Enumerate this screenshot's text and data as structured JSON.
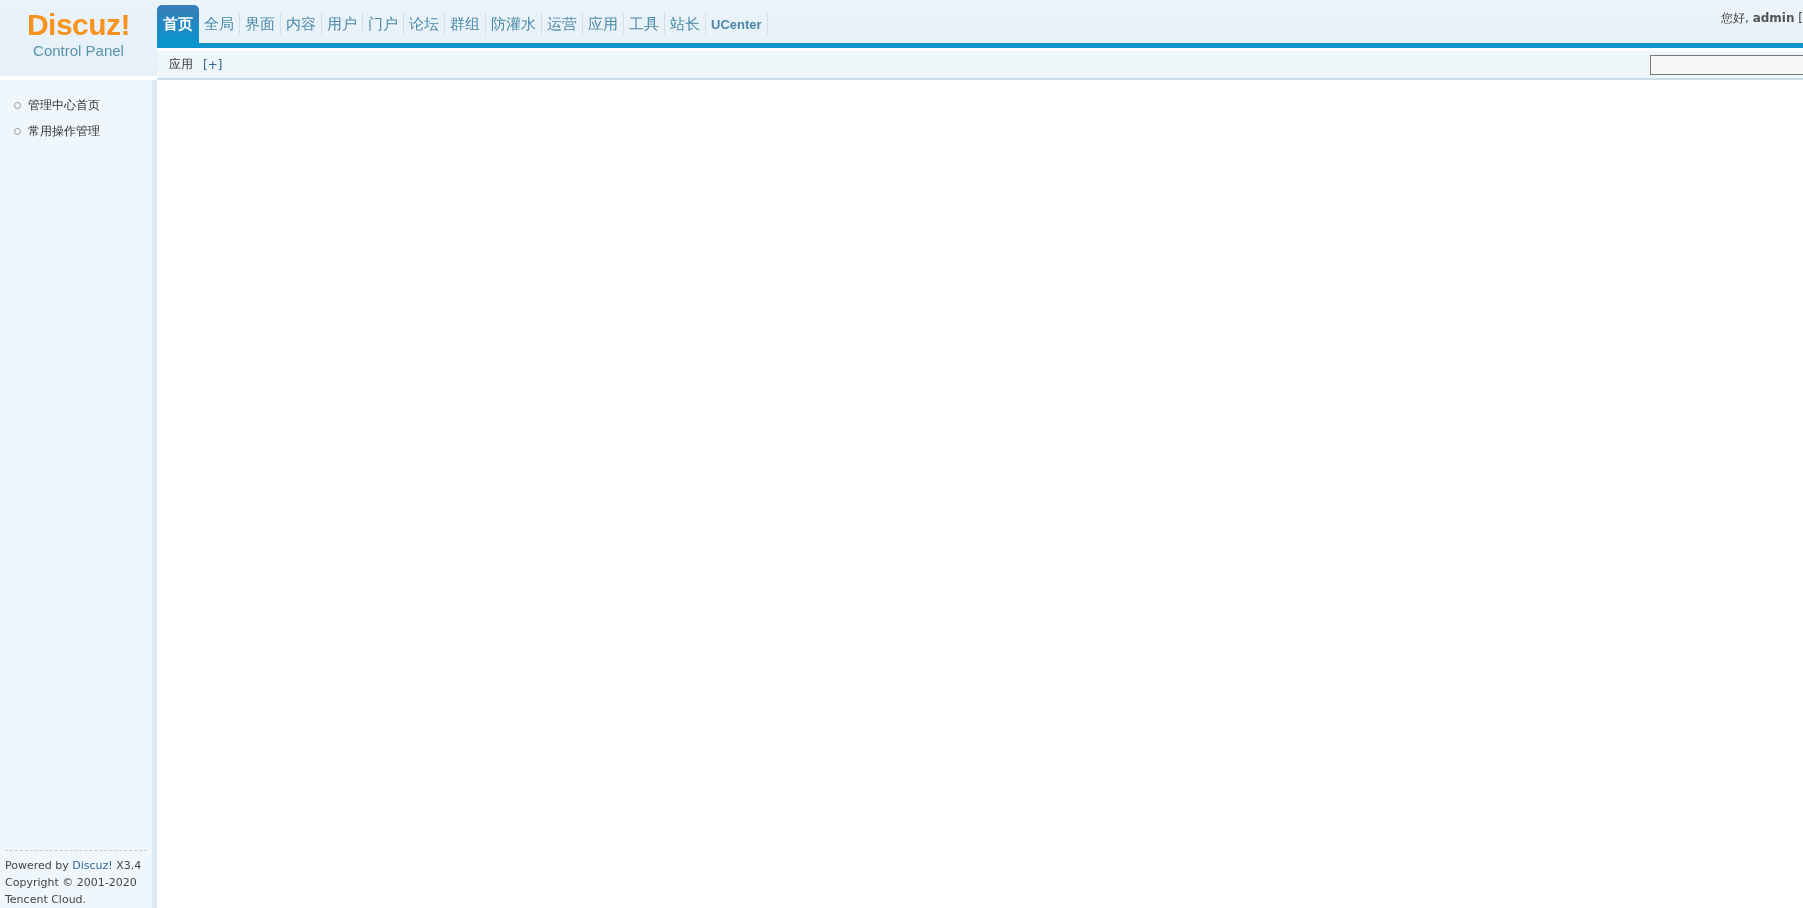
{
  "logo": {
    "title": "Discuz!",
    "subtitle": "Control Panel"
  },
  "tabs": [
    {
      "label": "首页",
      "selected": true
    },
    {
      "label": "全局",
      "selected": false
    },
    {
      "label": "界面",
      "selected": false
    },
    {
      "label": "内容",
      "selected": false
    },
    {
      "label": "用户",
      "selected": false
    },
    {
      "label": "门户",
      "selected": false
    },
    {
      "label": "论坛",
      "selected": false
    },
    {
      "label": "群组",
      "selected": false
    },
    {
      "label": "防灌水",
      "selected": false
    },
    {
      "label": "运营",
      "selected": false
    },
    {
      "label": "应用",
      "selected": false
    },
    {
      "label": "工具",
      "selected": false
    },
    {
      "label": "站长",
      "selected": false
    },
    {
      "label": "UCenter",
      "selected": false
    }
  ],
  "greeting": "您好, **admin** [",
  "subnav": {
    "label": "应用",
    "add_link": "[+]"
  },
  "sidebar": {
    "items": [
      "管理中心首页",
      "常用操作管理"
    ]
  },
  "footer": {
    "powered_by": "Powered by",
    "link": "Discuz!",
    "version": "X3.4",
    "copyright": "Copyright © 2001-2020",
    "company": "Tencent Cloud."
  }
}
